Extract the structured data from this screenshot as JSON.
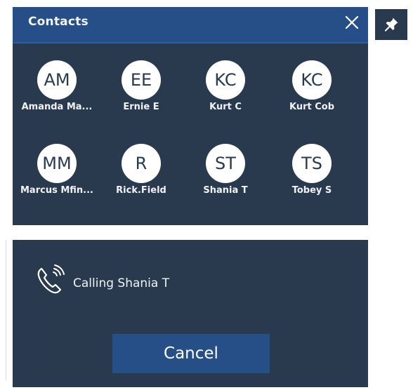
{
  "contacts_panel": {
    "title": "Contacts",
    "close_icon": "close-icon",
    "pin_icon": "pin-icon",
    "contacts": [
      {
        "initials": "AM",
        "name": "Amanda Ma..."
      },
      {
        "initials": "EE",
        "name": "Ernie E"
      },
      {
        "initials": "KC",
        "name": "Kurt C"
      },
      {
        "initials": "KC",
        "name": "Kurt Cob"
      },
      {
        "initials": "MM",
        "name": "Marcus Mfin..."
      },
      {
        "initials": "R",
        "name": "Rick.Field"
      },
      {
        "initials": "ST",
        "name": "Shania T"
      },
      {
        "initials": "TS",
        "name": "Tobey S"
      }
    ]
  },
  "calling_panel": {
    "status_icon": "phone-calling-icon",
    "status_text": "Calling Shania T",
    "cancel_label": "Cancel"
  },
  "colors": {
    "panel_bg": "#2a3a4e",
    "header_bg": "#274f87",
    "button_bg": "#274f87",
    "avatar_bg": "#ffffff",
    "text": "#f0f2f5"
  }
}
